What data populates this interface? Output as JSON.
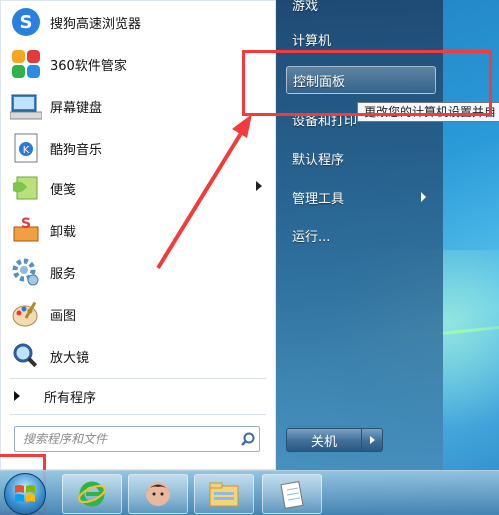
{
  "left_pane": {
    "programs": [
      {
        "label": "搜狗高速浏览器",
        "icon": "sogou-browser-icon",
        "has_submenu": false
      },
      {
        "label": "360软件管家",
        "icon": "360-software-manager-icon",
        "has_submenu": false
      },
      {
        "label": "屏幕键盘",
        "icon": "keyboard-icon",
        "has_submenu": false
      },
      {
        "label": "酷狗音乐",
        "icon": "kugou-music-icon",
        "has_submenu": false
      },
      {
        "label": "便笺",
        "icon": "sticky-notes-icon",
        "has_submenu": true
      },
      {
        "label": "卸载",
        "icon": "uninstall-icon",
        "has_submenu": false
      },
      {
        "label": "服务",
        "icon": "services-gear-icon",
        "has_submenu": false
      },
      {
        "label": "画图",
        "icon": "paint-palette-icon",
        "has_submenu": false
      },
      {
        "label": "放大镜",
        "icon": "magnifier-icon",
        "has_submenu": false
      }
    ],
    "all_programs": "所有程序",
    "search_placeholder": "搜索程序和文件"
  },
  "right_pane": {
    "items": {
      "games": "游戏",
      "computer": "计算机",
      "control_panel": "控制面板",
      "devices": "设备和打印",
      "default_programs": "默认程序",
      "admin_tools": "管理工具",
      "run": "运行..."
    },
    "tooltip": "更改您的计算机设置并自",
    "shutdown_label": "关机"
  },
  "colors": {
    "highlight_red": "#f33b3b",
    "menu_right_bg": "#1e466e"
  }
}
